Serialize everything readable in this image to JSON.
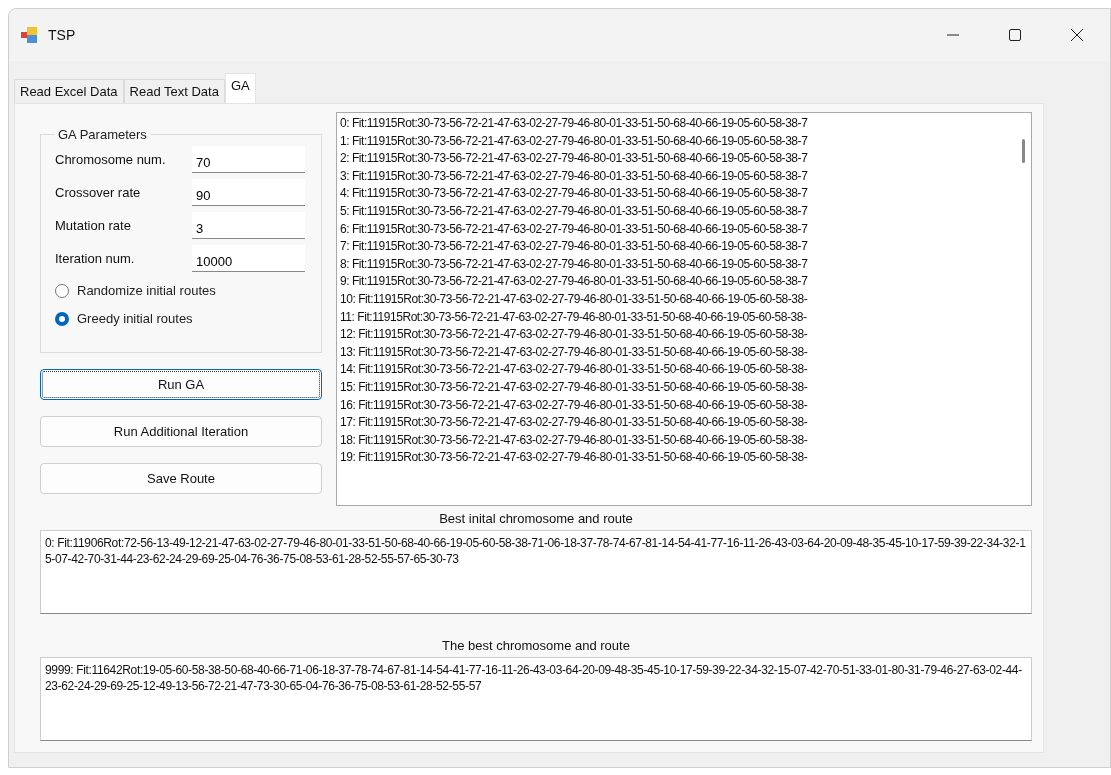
{
  "window": {
    "title": "TSP"
  },
  "tabs": [
    {
      "label": "Read Excel Data",
      "selected": false
    },
    {
      "label": "Read Text Data",
      "selected": false
    },
    {
      "label": "GA",
      "selected": true
    }
  ],
  "parameters": {
    "title": "GA Parameters",
    "fields": [
      {
        "label": "Chromosome num.",
        "value": "70"
      },
      {
        "label": "Crossover rate",
        "value": "90"
      },
      {
        "label": "Mutation rate",
        "value": "3"
      },
      {
        "label": "Iteration num.",
        "value": "10000"
      }
    ],
    "options": [
      {
        "label": "Randomize initial routes",
        "selected": false
      },
      {
        "label": "Greedy initial routes",
        "selected": true
      }
    ]
  },
  "buttons": [
    {
      "label": "Run GA",
      "focused": true
    },
    {
      "label": "Run Additional Iteration",
      "focused": false
    },
    {
      "label": "Save Route",
      "focused": false
    }
  ],
  "population": [
    "0: Fit:11915Rot:30-73-56-72-21-47-63-02-27-79-46-80-01-33-51-50-68-40-66-19-05-60-58-38-7",
    "1: Fit:11915Rot:30-73-56-72-21-47-63-02-27-79-46-80-01-33-51-50-68-40-66-19-05-60-58-38-7",
    "2: Fit:11915Rot:30-73-56-72-21-47-63-02-27-79-46-80-01-33-51-50-68-40-66-19-05-60-58-38-7",
    "3: Fit:11915Rot:30-73-56-72-21-47-63-02-27-79-46-80-01-33-51-50-68-40-66-19-05-60-58-38-7",
    "4: Fit:11915Rot:30-73-56-72-21-47-63-02-27-79-46-80-01-33-51-50-68-40-66-19-05-60-58-38-7",
    "5: Fit:11915Rot:30-73-56-72-21-47-63-02-27-79-46-80-01-33-51-50-68-40-66-19-05-60-58-38-7",
    "6: Fit:11915Rot:30-73-56-72-21-47-63-02-27-79-46-80-01-33-51-50-68-40-66-19-05-60-58-38-7",
    "7: Fit:11915Rot:30-73-56-72-21-47-63-02-27-79-46-80-01-33-51-50-68-40-66-19-05-60-58-38-7",
    "8: Fit:11915Rot:30-73-56-72-21-47-63-02-27-79-46-80-01-33-51-50-68-40-66-19-05-60-58-38-7",
    "9: Fit:11915Rot:30-73-56-72-21-47-63-02-27-79-46-80-01-33-51-50-68-40-66-19-05-60-58-38-7",
    "10: Fit:11915Rot:30-73-56-72-21-47-63-02-27-79-46-80-01-33-51-50-68-40-66-19-05-60-58-38-",
    "11: Fit:11915Rot:30-73-56-72-21-47-63-02-27-79-46-80-01-33-51-50-68-40-66-19-05-60-58-38-",
    "12: Fit:11915Rot:30-73-56-72-21-47-63-02-27-79-46-80-01-33-51-50-68-40-66-19-05-60-58-38-",
    "13: Fit:11915Rot:30-73-56-72-21-47-63-02-27-79-46-80-01-33-51-50-68-40-66-19-05-60-58-38-",
    "14: Fit:11915Rot:30-73-56-72-21-47-63-02-27-79-46-80-01-33-51-50-68-40-66-19-05-60-58-38-",
    "15: Fit:11915Rot:30-73-56-72-21-47-63-02-27-79-46-80-01-33-51-50-68-40-66-19-05-60-58-38-",
    "16: Fit:11915Rot:30-73-56-72-21-47-63-02-27-79-46-80-01-33-51-50-68-40-66-19-05-60-58-38-",
    "17: Fit:11915Rot:30-73-56-72-21-47-63-02-27-79-46-80-01-33-51-50-68-40-66-19-05-60-58-38-",
    "18: Fit:11915Rot:30-73-56-72-21-47-63-02-27-79-46-80-01-33-51-50-68-40-66-19-05-60-58-38-",
    "19: Fit:11915Rot:30-73-56-72-21-47-63-02-27-79-46-80-01-33-51-50-68-40-66-19-05-60-58-38-"
  ],
  "results": [
    {
      "label": "Best inital chromosome and route",
      "value": "0: Fit:11906Rot:72-56-13-49-12-21-47-63-02-27-79-46-80-01-33-51-50-68-40-66-19-05-60-58-38-71-06-18-37-78-74-67-81-14-54-41-77-16-11-26-43-03-64-20-09-48-35-45-10-17-59-39-22-34-32-15-07-42-70-31-44-23-62-24-29-69-25-04-76-36-75-08-53-61-28-52-55-57-65-30-73"
    },
    {
      "label": "The best chromosome and route",
      "value": "9999: Fit:11642Rot:19-05-60-58-38-50-68-40-66-71-06-18-37-78-74-67-81-14-54-41-77-16-11-26-43-03-64-20-09-48-35-45-10-17-59-39-22-34-32-15-07-42-70-51-33-01-80-31-79-46-27-63-02-44-23-62-24-29-69-25-12-49-13-56-72-21-47-73-30-65-04-76-36-75-08-53-61-28-52-55-57"
    }
  ]
}
